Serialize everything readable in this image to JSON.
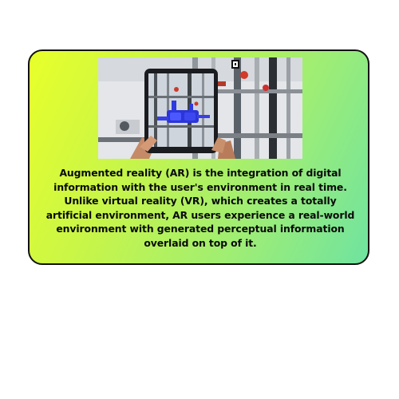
{
  "card": {
    "caption": "Augmented reality (AR) is the integration of digital information with the user's environment in real time. Unlike virtual reality (VR), which creates a totally artificial environment, AR users experience a real-world environment with generated perceptual information overlaid on top of it.",
    "photo_subject": "hands holding a tablet showing an AR overlay of blue piping in an industrial room",
    "gradient_colors": [
      "#e8ff2a",
      "#c6f54a",
      "#9ced77",
      "#6fe3a0"
    ],
    "border_color": "#111111"
  }
}
